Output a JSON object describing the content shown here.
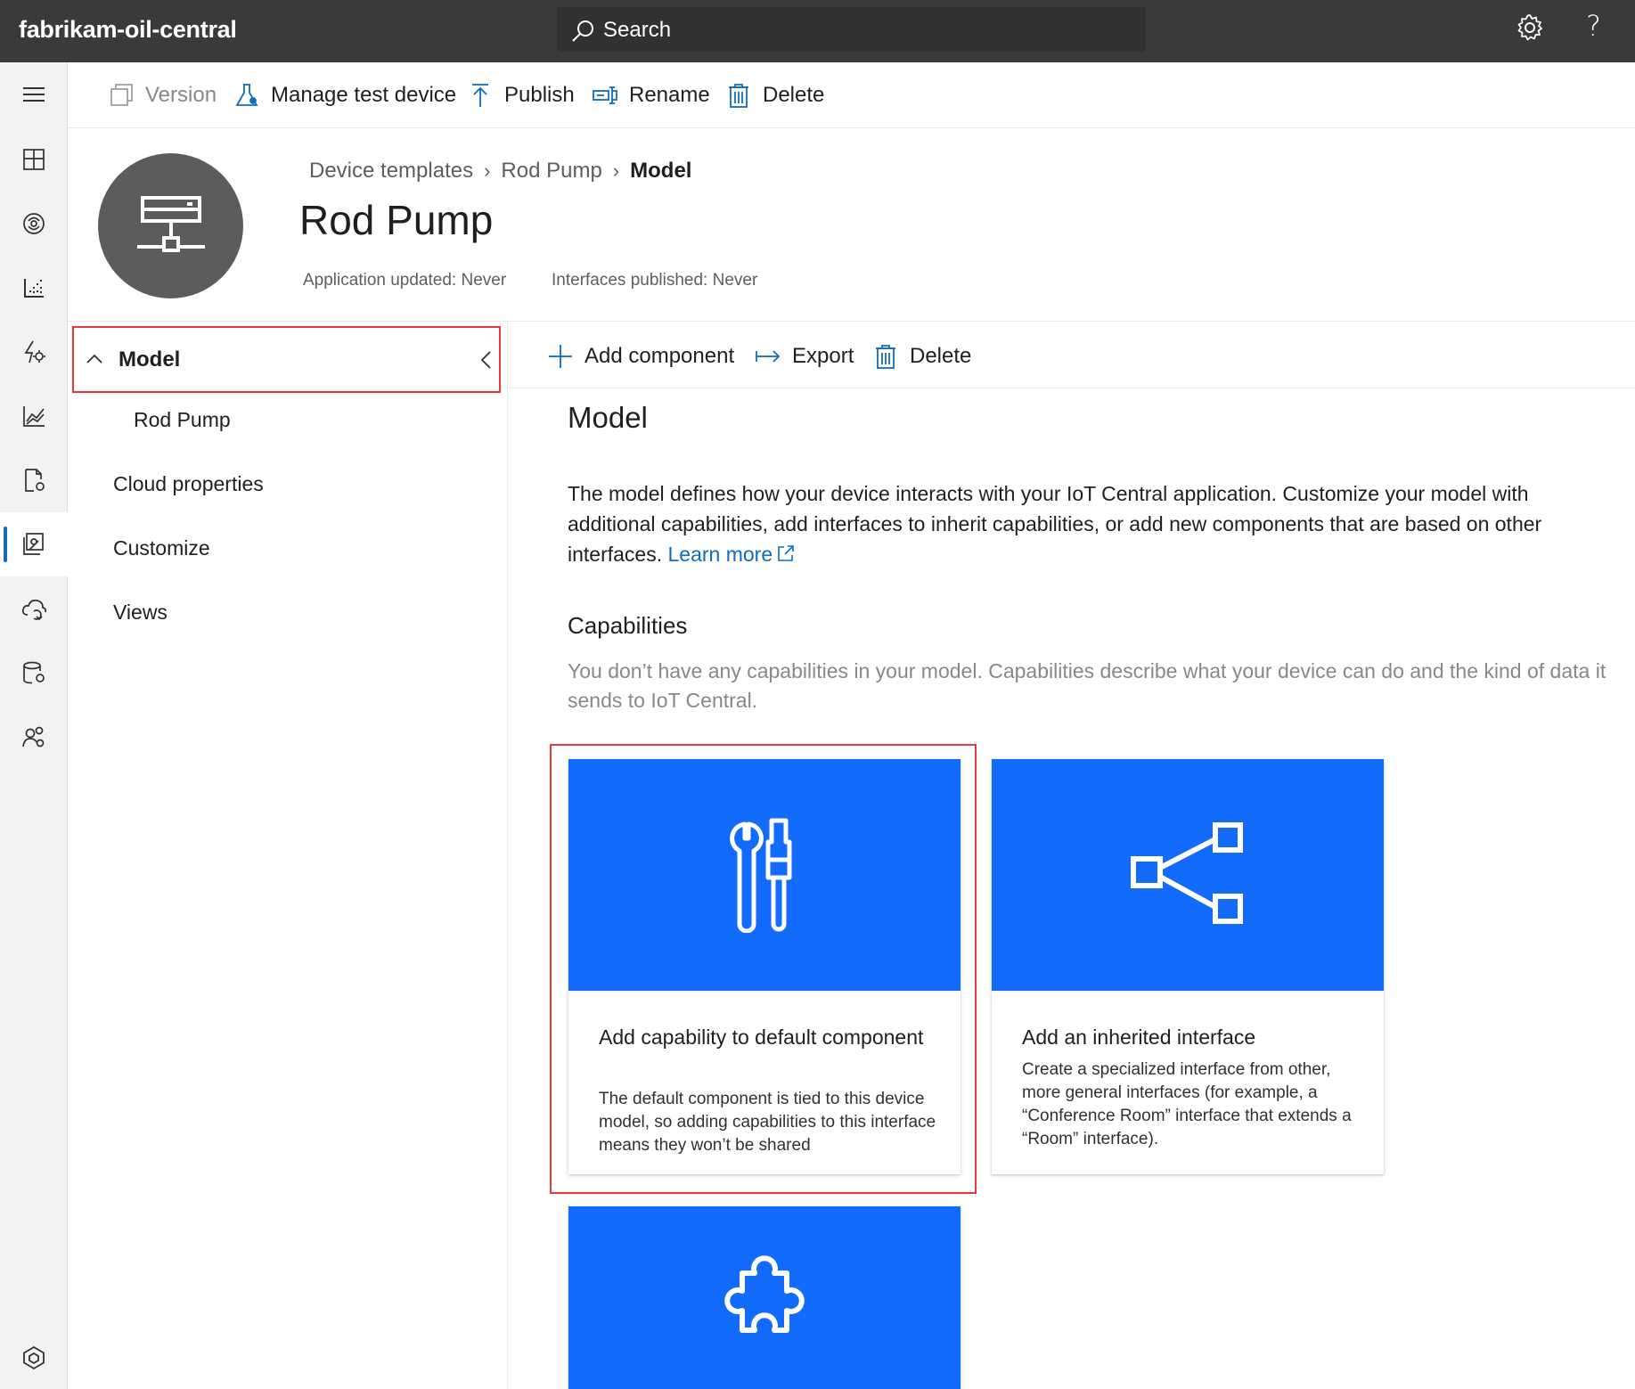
{
  "app": {
    "title": "fabrikam-oil-central"
  },
  "search": {
    "label": "Search"
  },
  "topbar": {
    "settings_icon": "gear-icon",
    "help_label": "?"
  },
  "rail": {
    "items": [
      {
        "name": "menu",
        "icon": "hamburger-icon"
      },
      {
        "name": "dashboards",
        "icon": "dashboard-icon"
      },
      {
        "name": "devices",
        "icon": "device-icon"
      },
      {
        "name": "device-groups",
        "icon": "device-groups-icon"
      },
      {
        "name": "rules",
        "icon": "rules-icon"
      },
      {
        "name": "analytics",
        "icon": "analytics-icon"
      },
      {
        "name": "jobs",
        "icon": "jobs-icon"
      },
      {
        "name": "device-templates",
        "icon": "device-templates-icon",
        "active": true
      },
      {
        "name": "data-export",
        "icon": "data-export-icon"
      },
      {
        "name": "administration",
        "icon": "administration-icon"
      },
      {
        "name": "users",
        "icon": "users-icon"
      },
      {
        "name": "iot-central",
        "icon": "iot-central-icon"
      }
    ]
  },
  "toolbar": {
    "version": "Version",
    "manage_test_device": "Manage test device",
    "publish": "Publish",
    "rename": "Rename",
    "delete": "Delete"
  },
  "header": {
    "breadcrumb": [
      "Device templates",
      "Rod Pump",
      "Model"
    ],
    "title": "Rod Pump",
    "app_updated": "Application updated: Never",
    "interfaces_published": "Interfaces published: Never"
  },
  "tree": {
    "head": "Model",
    "items": [
      "Rod Pump",
      "Cloud properties",
      "Customize",
      "Views"
    ]
  },
  "content_toolbar": {
    "add_component": "Add component",
    "export": "Export",
    "delete": "Delete"
  },
  "model": {
    "title": "Model",
    "description": "The model defines how your device interacts with your IoT Central application. Customize your model with additional capabilities, add interfaces to inherit capabilities, or add new components that are based on other interfaces.",
    "learn_more": "Learn more",
    "capabilities_title": "Capabilities",
    "capabilities_empty": "You don’t have any capabilities in your model. Capabilities describe what your device can do and the kind of data it sends to IoT Central."
  },
  "cards": [
    {
      "title": "Add capability to default component",
      "text": "The default component is tied to this device model, so adding capabilities to this interface means they won’t be shared",
      "icon": "tools-icon"
    },
    {
      "title": "Add an inherited interface",
      "text": "Create a specialized interface from other, more general interfaces (for example, a “Conference Room” interface that extends a “Room” interface).",
      "icon": "share-icon"
    },
    {
      "title": "",
      "text": "",
      "icon": "puzzle-icon"
    }
  ],
  "colors": {
    "accent": "#0f6cbd",
    "card_banner": "#136bfb",
    "highlight": "#e8383d",
    "topbar": "#3b3a39"
  }
}
